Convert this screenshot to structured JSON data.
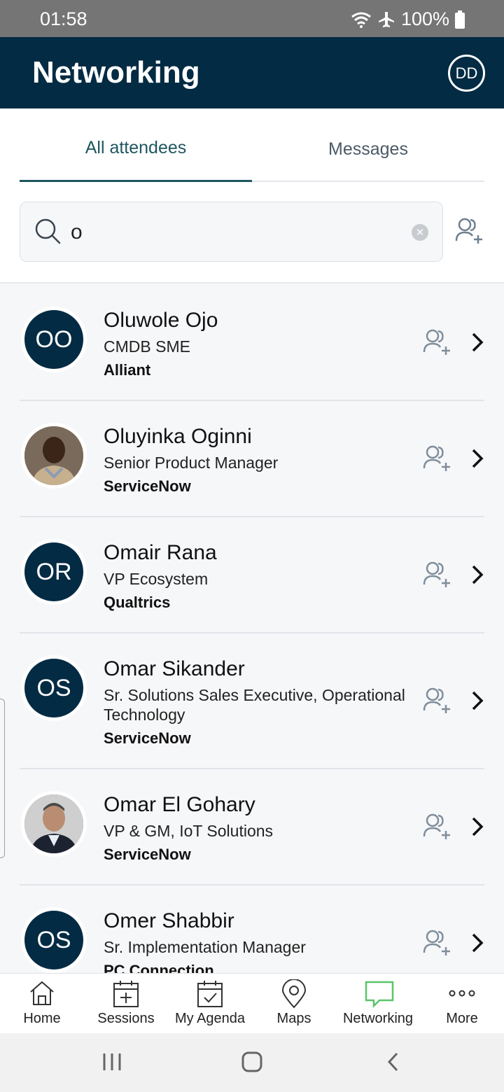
{
  "status_bar": {
    "time": "01:58",
    "battery": "100%"
  },
  "header": {
    "title": "Networking",
    "profile_initials": "DD"
  },
  "tabs": [
    {
      "label": "All attendees",
      "active": true
    },
    {
      "label": "Messages",
      "active": false
    }
  ],
  "search": {
    "value": "o"
  },
  "attendees": [
    {
      "initials": "OO",
      "photo": false,
      "name": "Oluwole Ojo",
      "title": "CMDB SME",
      "company": "Alliant"
    },
    {
      "initials": "",
      "photo": true,
      "name": "Oluyinka Oginni",
      "title": "Senior Product Manager",
      "company": "ServiceNow"
    },
    {
      "initials": "OR",
      "photo": false,
      "name": "Omair Rana",
      "title": "VP Ecosystem",
      "company": "Qualtrics"
    },
    {
      "initials": "OS",
      "photo": false,
      "name": "Omar Sikander",
      "title": "Sr. Solutions Sales Executive, Operational Technology",
      "company": "ServiceNow"
    },
    {
      "initials": "",
      "photo": true,
      "name": "Omar El Gohary",
      "title": "VP & GM, IoT Solutions",
      "company": "ServiceNow"
    },
    {
      "initials": "OS",
      "photo": false,
      "name": "Omer Shabbir",
      "title": "Sr. Implementation Manager",
      "company": "PC Connection"
    }
  ],
  "bottom_nav": [
    {
      "label": "Home",
      "icon": "home-icon",
      "active": false
    },
    {
      "label": "Sessions",
      "icon": "calendar-plus-icon",
      "active": false
    },
    {
      "label": "My Agenda",
      "icon": "calendar-check-icon",
      "active": false
    },
    {
      "label": "Maps",
      "icon": "map-pin-icon",
      "active": false
    },
    {
      "label": "Networking",
      "icon": "chat-bubble-icon",
      "active": true
    },
    {
      "label": "More",
      "icon": "more-dots-icon",
      "active": false
    }
  ],
  "colors": {
    "header_bg": "#032b43",
    "accent": "#1e5660",
    "active_nav": "#5cc46a"
  }
}
